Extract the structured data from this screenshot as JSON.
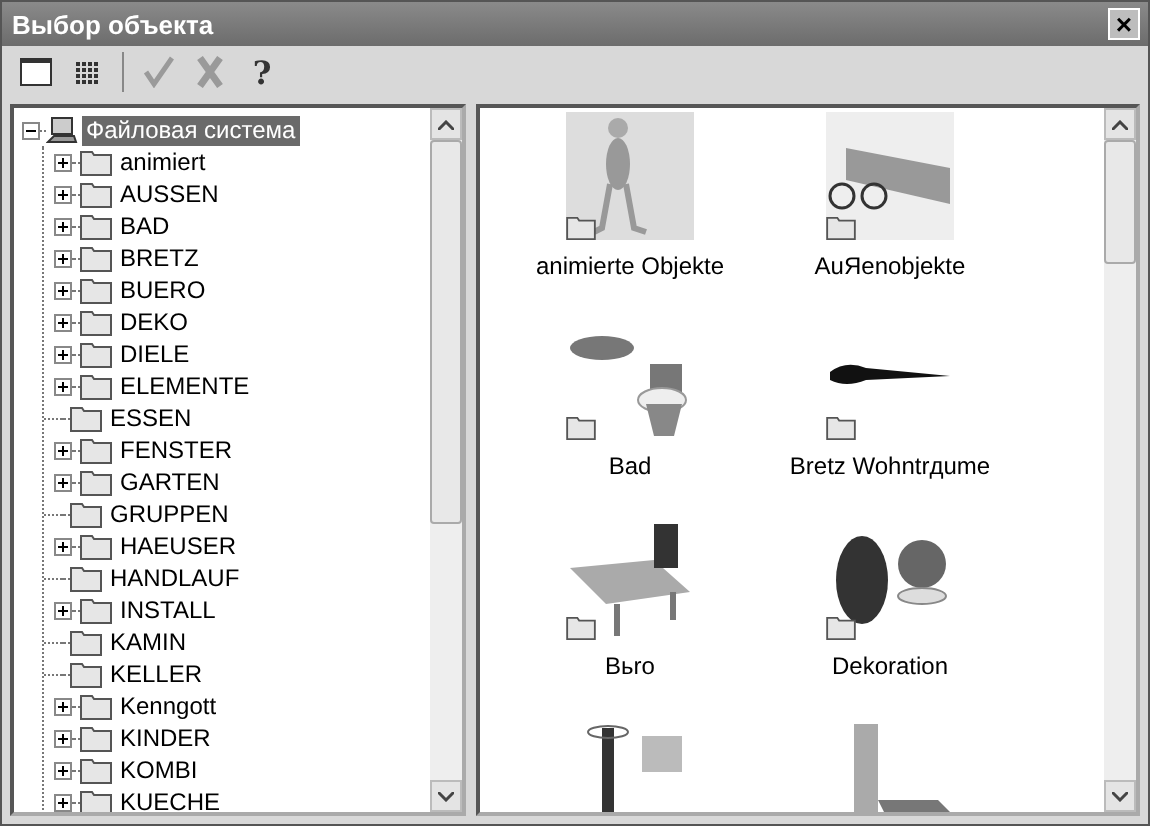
{
  "window": {
    "title": "Выбор объекта",
    "close": "×"
  },
  "toolbar": [
    {
      "kind": "window",
      "disabled": false
    },
    {
      "kind": "grid",
      "disabled": false
    },
    {
      "kind": "check",
      "disabled": true
    },
    {
      "kind": "cross",
      "disabled": true
    },
    {
      "kind": "help",
      "label": "?",
      "disabled": false
    }
  ],
  "tree": {
    "root": {
      "label": "Файловая система",
      "selected": true,
      "expanded": true,
      "children": [
        {
          "label": "animiert",
          "expandable": true,
          "selected": false
        },
        {
          "label": "AUSSEN",
          "expandable": true,
          "selected": false
        },
        {
          "label": "BAD",
          "expandable": true,
          "selected": false
        },
        {
          "label": "BRETZ",
          "expandable": true,
          "selected": false
        },
        {
          "label": "BUERO",
          "expandable": true,
          "selected": false
        },
        {
          "label": "DEKO",
          "expandable": true,
          "selected": false
        },
        {
          "label": "DIELE",
          "expandable": true,
          "selected": false
        },
        {
          "label": "ELEMENTE",
          "expandable": true,
          "selected": false
        },
        {
          "label": "ESSEN",
          "expandable": false,
          "selected": false
        },
        {
          "label": "FENSTER",
          "expandable": true,
          "selected": false
        },
        {
          "label": "GARTEN",
          "expandable": true,
          "selected": false
        },
        {
          "label": "GRUPPEN",
          "expandable": false,
          "selected": false
        },
        {
          "label": "HAEUSER",
          "expandable": true,
          "selected": false
        },
        {
          "label": "HANDLAUF",
          "expandable": false,
          "selected": false
        },
        {
          "label": "INSTALL",
          "expandable": true,
          "selected": false
        },
        {
          "label": "KAMIN",
          "expandable": false,
          "selected": false
        },
        {
          "label": "KELLER",
          "expandable": false,
          "selected": false
        },
        {
          "label": "Kenngott",
          "expandable": true,
          "selected": false
        },
        {
          "label": "KINDER",
          "expandable": true,
          "selected": false
        },
        {
          "label": "KOMBI",
          "expandable": true,
          "selected": false
        },
        {
          "label": "KUECHE",
          "expandable": true,
          "selected": false
        }
      ]
    }
  },
  "gallery": [
    {
      "kind": "picture",
      "label": "animierte Objekte"
    },
    {
      "kind": "picture",
      "label": "AuЯenobjekte"
    },
    {
      "kind": "picture",
      "label": "Bad"
    },
    {
      "kind": "picture",
      "label": "Bretz Wohntrдume"
    },
    {
      "kind": "picture",
      "label": "Вьro"
    },
    {
      "kind": "picture",
      "label": "Dekoration"
    },
    {
      "kind": "picture"
    },
    {
      "kind": "picture"
    }
  ]
}
